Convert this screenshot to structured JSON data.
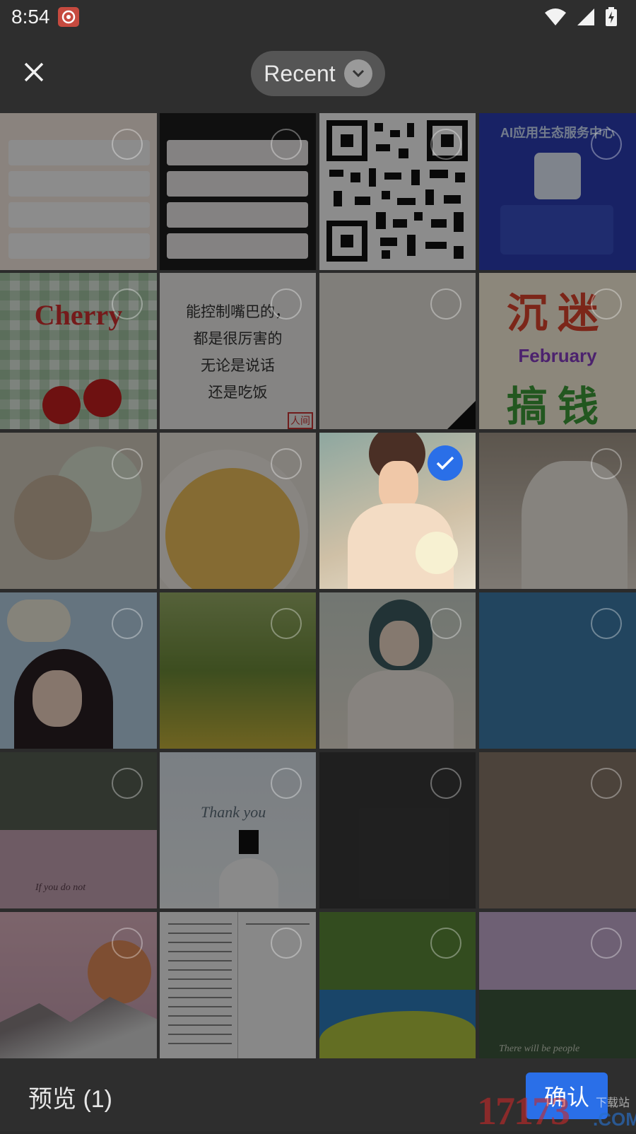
{
  "status_bar": {
    "time": "8:54",
    "icons": [
      "app-notification-icon",
      "wifi-icon",
      "signal-icon",
      "battery-charging-icon"
    ]
  },
  "header": {
    "close_icon": "close-icon",
    "album_selector": {
      "label": "Recent",
      "icon": "chevron-down-icon"
    }
  },
  "grid": {
    "columns": 4,
    "selected_count": 1,
    "tiles": [
      {
        "name": "app-screenshot-list",
        "selected": false
      },
      {
        "name": "app-screenshot-cards",
        "selected": false
      },
      {
        "name": "qr-code",
        "selected": false
      },
      {
        "name": "ai-poster",
        "text": "AI应用生态服务中心",
        "selected": false
      },
      {
        "name": "cherry-picture",
        "text": "Cherry",
        "selected": false
      },
      {
        "name": "handwritten-quote",
        "lines": [
          "能控制嘴巴的，",
          "都是很厉害的",
          "无论是说话",
          "还是吃饭"
        ],
        "stamp": "人间",
        "selected": false
      },
      {
        "name": "paper-note",
        "selected": false
      },
      {
        "name": "february-poster",
        "lines": [
          "沉迷",
          "February",
          "搞钱"
        ],
        "selected": false
      },
      {
        "name": "food-photo",
        "selected": false
      },
      {
        "name": "noodle-bowl-photo",
        "selected": false
      },
      {
        "name": "girl-with-lilies",
        "selected": true
      },
      {
        "name": "girl-with-flowers",
        "selected": false
      },
      {
        "name": "anime-girl",
        "selected": false
      },
      {
        "name": "flower-meadow",
        "selected": false
      },
      {
        "name": "girl-illustration",
        "selected": false
      },
      {
        "name": "blue-wallpaper",
        "selected": false
      },
      {
        "name": "pink-wallpaper",
        "text": "If you do not",
        "selected": false
      },
      {
        "name": "thank-you-card",
        "text": "Thank you",
        "selected": false
      },
      {
        "name": "dark-image",
        "selected": false
      },
      {
        "name": "brown-image",
        "selected": false
      },
      {
        "name": "mountain-moon",
        "selected": false
      },
      {
        "name": "text-document",
        "selected": false
      },
      {
        "name": "trees-lake",
        "selected": false
      },
      {
        "name": "purple-green-card",
        "text": "There will be people",
        "selected": false
      }
    ]
  },
  "footer": {
    "preview_label": "预览 (1)",
    "confirm_label": "确认"
  },
  "watermark": {
    "digits": "17173",
    "cn": "下载站",
    "com": ".COM"
  },
  "colors": {
    "accent": "#2a6fe8",
    "background": "#2b2b2b"
  }
}
